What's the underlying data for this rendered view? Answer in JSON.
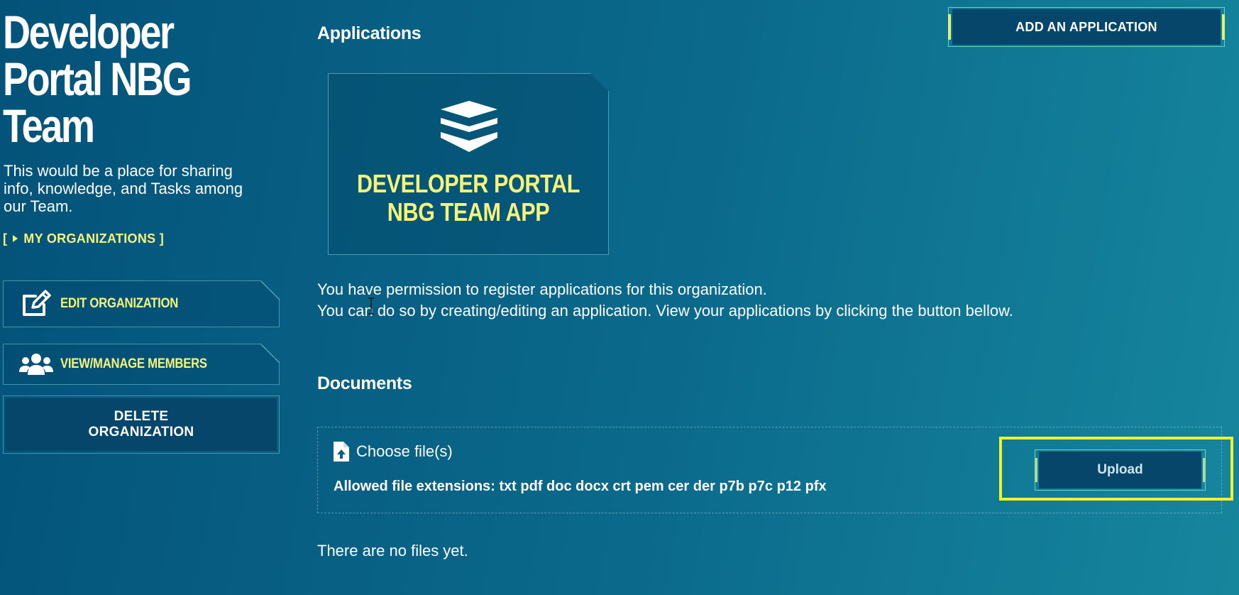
{
  "sidebar": {
    "org_title": "Developer Portal NBG Team",
    "org_description": "This would be a place for sharing info, knowledge, and Tasks among our Team.",
    "my_orgs_open": "[",
    "my_orgs_label": "MY ORGANIZATIONS",
    "my_orgs_close": "]",
    "edit_org_label": "EDIT ORGANIZATION",
    "manage_members_label": "VIEW/MANAGE MEMBERS",
    "delete_org_label": "DELETE\nORGANIZATION"
  },
  "applications": {
    "title": "Applications",
    "add_button_label": "ADD AN APPLICATION",
    "items": [
      {
        "name": "DEVELOPER PORTAL\nNBG TEAM APP",
        "icon": "layers-icon"
      }
    ],
    "permission_text": "You have permission to register applications for this organization.\nYou can do so by creating/editing an application. View your applications by clicking the button bellow."
  },
  "documents": {
    "title": "Documents",
    "choose_files_label": "Choose file(s)",
    "allowed_extensions": "Allowed file extensions: txt pdf doc docx crt pem cer der p7b p7c p12 pfx",
    "upload_button_label": "Upload",
    "empty_message": "There are no files yet."
  },
  "colors": {
    "accent_yellow": "#f6f37a",
    "highlight_yellow": "#eef22f",
    "button_fill": "#05466a",
    "background_start": "#035279",
    "background_end": "#16869d"
  }
}
